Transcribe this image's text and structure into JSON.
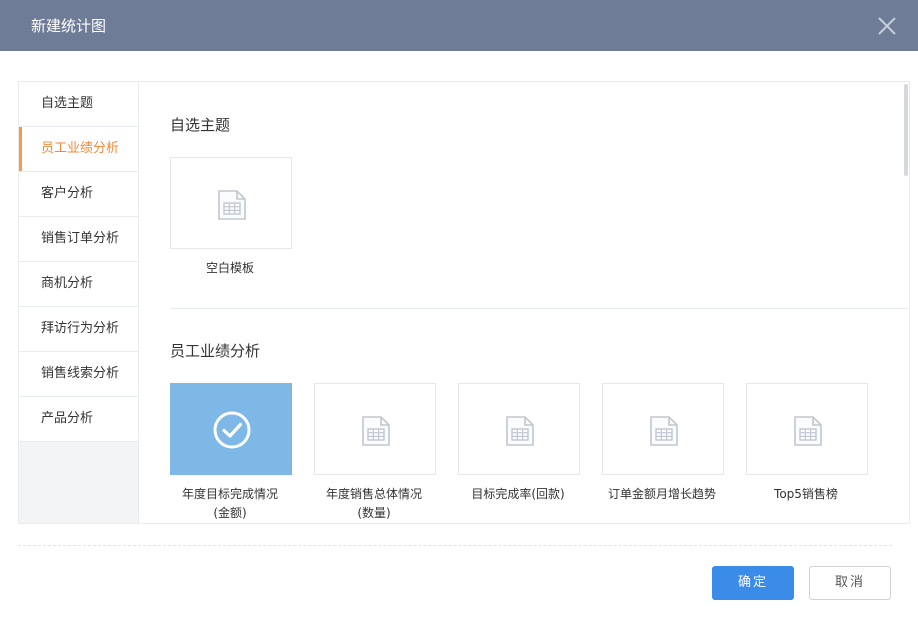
{
  "dialog": {
    "title": "新建统计图"
  },
  "sidebar": {
    "items": [
      {
        "label": "自选主题"
      },
      {
        "label": "员工业绩分析"
      },
      {
        "label": "客户分析"
      },
      {
        "label": "销售订单分析"
      },
      {
        "label": "商机分析"
      },
      {
        "label": "拜访行为分析"
      },
      {
        "label": "销售线索分析"
      },
      {
        "label": "产品分析"
      }
    ],
    "active_index": 1
  },
  "sections": [
    {
      "title": "自选主题",
      "cards": [
        {
          "label": "空白模板"
        }
      ]
    },
    {
      "title": "员工业绩分析",
      "cards": [
        {
          "label": "年度目标完成情况",
          "label2": "(金额)",
          "selected": true
        },
        {
          "label": "年度销售总体情况",
          "label2": "(数量)"
        },
        {
          "label": "目标完成率(回款)"
        },
        {
          "label": "订单金额月增长趋势"
        },
        {
          "label": "Top5销售榜"
        }
      ]
    }
  ],
  "footer": {
    "ok_label": "确定",
    "cancel_label": "取消"
  },
  "colors": {
    "titlebar": "#6f7c97",
    "active_accent": "#f59b45",
    "selected_card": "#7db8e6",
    "primary_button": "#3b8be8"
  },
  "icons": {
    "close": "close-icon",
    "template": "spreadsheet-doc-icon",
    "selected": "check-circle-icon"
  }
}
